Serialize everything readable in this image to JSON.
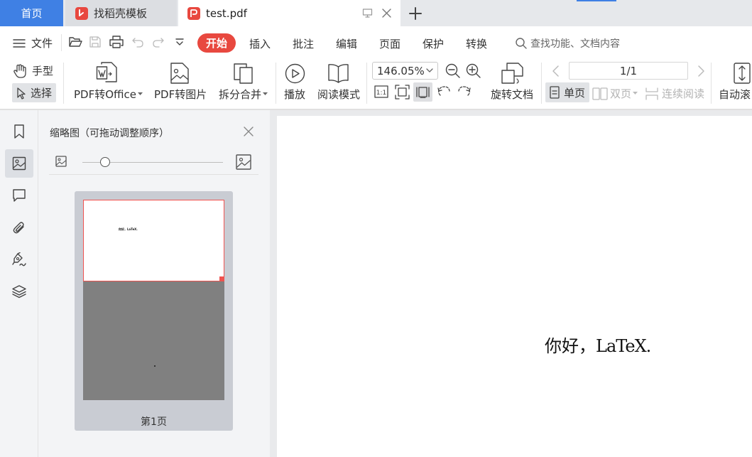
{
  "tabs": {
    "home": "首页",
    "template": "找稻壳模板",
    "file": "test.pdf"
  },
  "menu": {
    "file": "文件",
    "items": [
      "开始",
      "插入",
      "批注",
      "编辑",
      "页面",
      "保护",
      "转换"
    ],
    "search_placeholder": "查找功能、文档内容"
  },
  "ribbon": {
    "hand": "手型",
    "select": "选择",
    "pdf_to_office": "PDF转Office",
    "pdf_to_image": "PDF转图片",
    "split_merge": "拆分合并",
    "play": "播放",
    "read_mode": "阅读模式",
    "zoom": "146.05%",
    "rotate_doc": "旋转文档",
    "page_indicator": "1/1",
    "single_page": "单页",
    "double_page": "双页",
    "continuous_read": "连续阅读",
    "auto_scroll": "自动滚"
  },
  "thumbnail_panel": {
    "title": "缩略图（可拖动调整顺序）",
    "page_label": "第1页",
    "mini_text": "你好，LaTeX."
  },
  "document": {
    "text": "你好，",
    "latex": "LaTeX."
  },
  "colors": {
    "accent": "#3f80e4",
    "start_button": "#e8483f",
    "pdf_icon": "#e8483f"
  }
}
